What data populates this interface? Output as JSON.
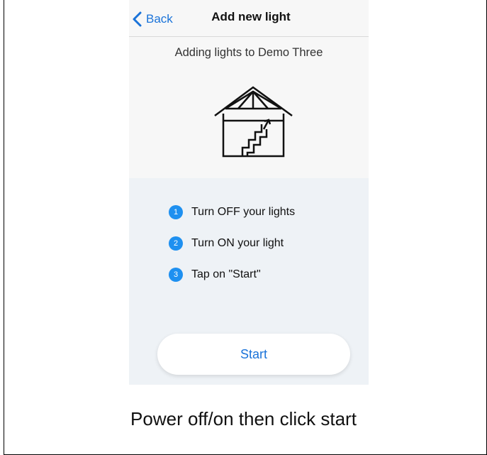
{
  "navbar": {
    "back_label": "Back",
    "title": "Add new light"
  },
  "subtitle": "Adding lights to Demo Three",
  "illustration_icon": "house-with-stairs-icon",
  "steps": [
    {
      "number": "1",
      "text": "Turn OFF your lights"
    },
    {
      "number": "2",
      "text": "Turn ON your light"
    },
    {
      "number": "3",
      "text": "Tap on \"Start\""
    }
  ],
  "start_button_label": "Start",
  "caption": "Power off/on then click start",
  "colors": {
    "accent": "#1a73d9",
    "step_badge": "#1e90f0",
    "steps_background": "#eef2f6",
    "header_background": "#f7f7f7"
  }
}
